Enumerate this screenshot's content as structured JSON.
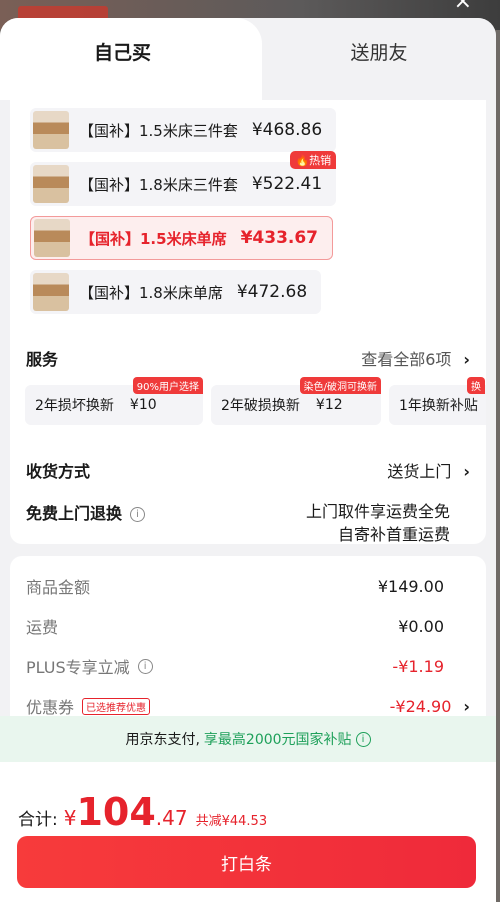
{
  "tabs": {
    "self": "自己买",
    "gift": "送朋友"
  },
  "options": [
    {
      "name": "【国补】1.5米床三件套",
      "price": "¥468.86",
      "badge": ""
    },
    {
      "name": "【国补】1.8米床三件套",
      "price": "¥522.41",
      "badge": "🔥热销"
    },
    {
      "name": "【国补】1.5米床单席",
      "price": "¥433.67",
      "badge": ""
    },
    {
      "name": "【国补】1.8米床单席",
      "price": "¥472.68",
      "badge": ""
    }
  ],
  "services": {
    "title": "服务",
    "view_all": "查看全部6项",
    "items": [
      {
        "name": "2年损坏换新",
        "price": "¥10",
        "badge": "90%用户选择"
      },
      {
        "name": "2年破损换新",
        "price": "¥12",
        "badge": "染色/破洞可换新"
      },
      {
        "name": "1年换新补贴",
        "price": "",
        "badge": "换"
      }
    ]
  },
  "delivery": {
    "label": "收货方式",
    "value": "送货上门"
  },
  "free_return": {
    "label": "免费上门退换",
    "line1": "上门取件享运费全免",
    "line2": "自寄补首重运费"
  },
  "summary": {
    "goods_label": "商品金额",
    "goods_value": "¥149.00",
    "shipping_label": "运费",
    "shipping_value": "¥0.00",
    "plus_label": "PLUS专享立减",
    "plus_value": "-¥1.19",
    "coupon_label": "优惠券",
    "coupon_tag": "已选推荐优惠",
    "coupon_value": "-¥24.90"
  },
  "banner": {
    "text": "用京东支付,",
    "highlight": "享最高2000元国家补贴"
  },
  "total": {
    "label": "合计:",
    "currency": "¥",
    "integer": "104",
    "decimal": ".47",
    "saved": "共减¥44.53"
  },
  "pay_button": "打白条",
  "colors": {
    "accent": "#e6232c",
    "banner_green": "#1ea05a"
  },
  "icons": {
    "close": "close-icon",
    "chevron": "chevron-right-icon",
    "info": "info-icon"
  }
}
